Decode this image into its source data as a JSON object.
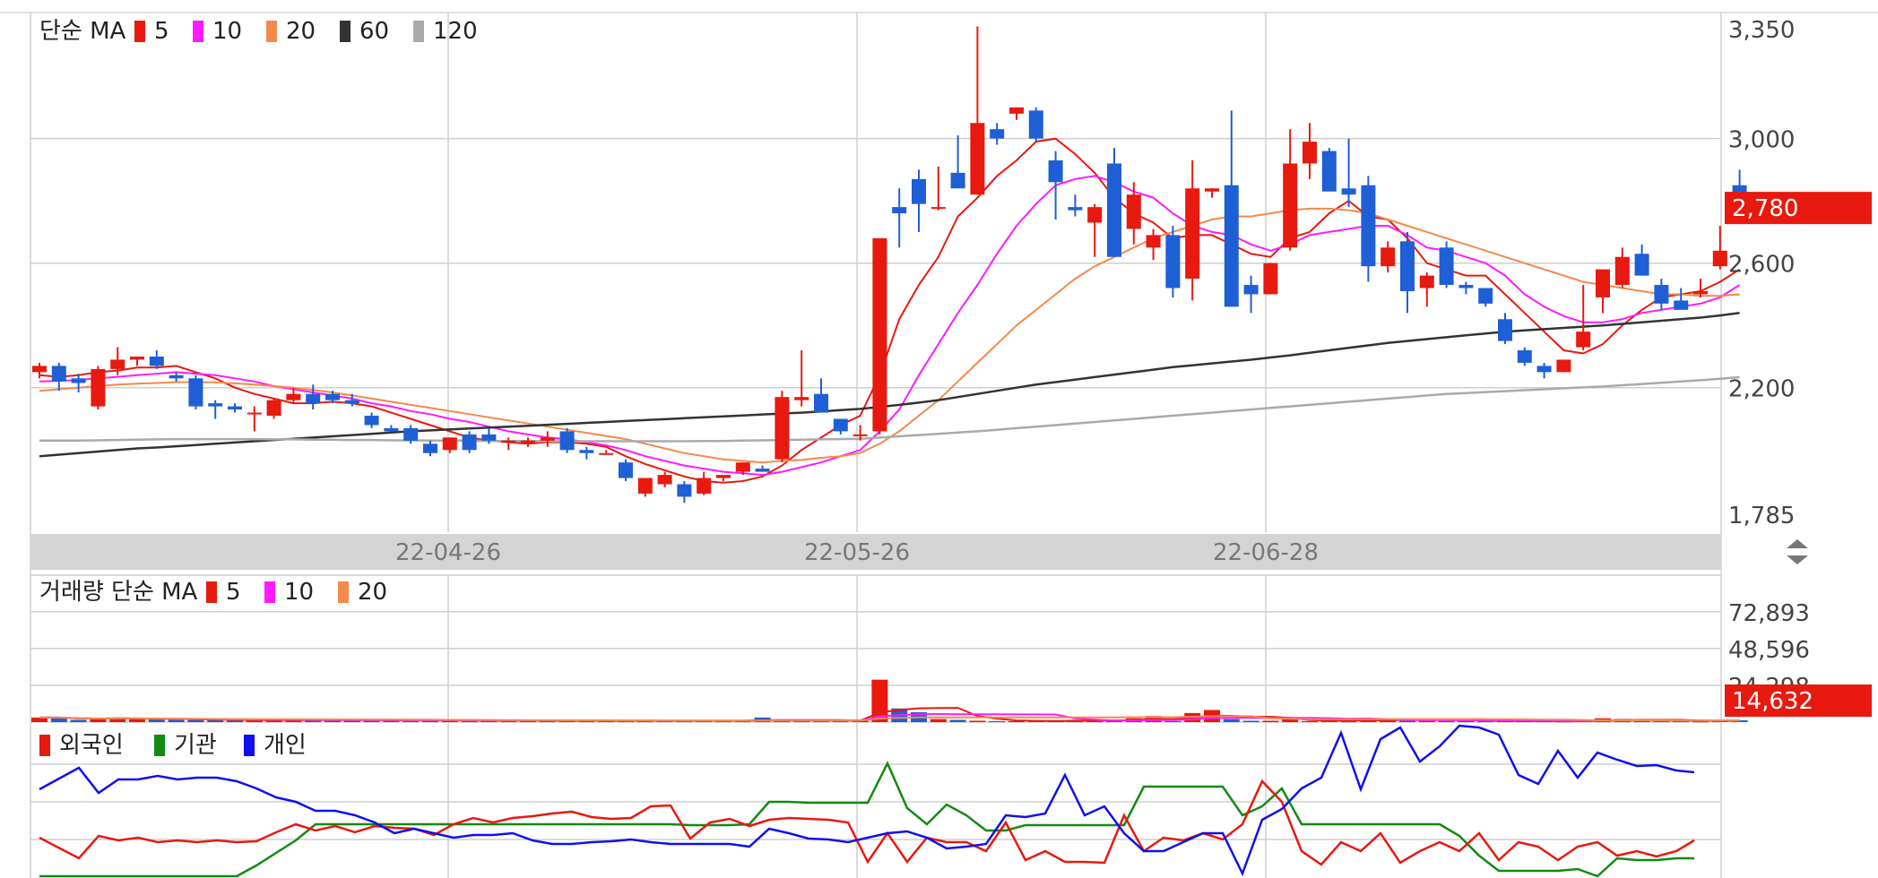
{
  "colors": {
    "up": "#e8190f",
    "down": "#1f5fd6",
    "ma5": "#e8190f",
    "ma10": "#ff1aff",
    "ma20": "#f4894b",
    "ma60": "#333333",
    "ma120": "#aaaaaa",
    "foreign": "#e8190f",
    "institution": "#138a13",
    "individual": "#1010ee",
    "grid": "#cfcfcf",
    "axisband": "#d4d4d4",
    "label_bg": "#e8190f"
  },
  "price_panel": {
    "legend_title": "단순 MA",
    "legend": [
      {
        "label": "5",
        "color": "#e8190f"
      },
      {
        "label": "10",
        "color": "#ff1aff"
      },
      {
        "label": "20",
        "color": "#f4894b"
      },
      {
        "label": "60",
        "color": "#333333"
      },
      {
        "label": "120",
        "color": "#aaaaaa"
      }
    ],
    "y_ticks": [
      "3,350",
      "3,000",
      "2,600",
      "2,200",
      "1,785"
    ],
    "current_label": "2,780"
  },
  "date_axis": {
    "labels": [
      "22-04-26",
      "22-05-26",
      "22-06-28"
    ]
  },
  "volume_panel": {
    "legend_title": "거래량 단순 MA",
    "legend": [
      {
        "label": "5",
        "color": "#e8190f"
      },
      {
        "label": "10",
        "color": "#ff1aff"
      },
      {
        "label": "20",
        "color": "#f4894b"
      }
    ],
    "y_ticks": [
      "72,893",
      "48,596",
      "24,298"
    ],
    "current_label": "14,632"
  },
  "investor_panel": {
    "legend": [
      {
        "label": "외국인",
        "color": "#e8190f"
      },
      {
        "label": "기관",
        "color": "#138a13"
      },
      {
        "label": "개인",
        "color": "#1010ee"
      }
    ]
  },
  "chart_data": {
    "type": "candlestick",
    "x_tick_labels": [
      "22-04-26",
      "22-05-26",
      "22-06-28"
    ],
    "price_ylim": [
      1785,
      3350
    ],
    "candles": [
      [
        2250,
        2280,
        2230,
        2270
      ],
      [
        2270,
        2280,
        2190,
        2220
      ],
      [
        2230,
        2245,
        2185,
        2215
      ],
      [
        2140,
        2270,
        2130,
        2260
      ],
      [
        2260,
        2330,
        2240,
        2290
      ],
      [
        2290,
        2300,
        2270,
        2300
      ],
      [
        2300,
        2320,
        2260,
        2270
      ],
      [
        2240,
        2250,
        2220,
        2230
      ],
      [
        2230,
        2240,
        2130,
        2140
      ],
      [
        2150,
        2160,
        2100,
        2140
      ],
      [
        2140,
        2150,
        2120,
        2130
      ],
      [
        2120,
        2140,
        2060,
        2120
      ],
      [
        2110,
        2165,
        2100,
        2160
      ],
      [
        2160,
        2200,
        2150,
        2180
      ],
      [
        2180,
        2210,
        2130,
        2150
      ],
      [
        2180,
        2190,
        2150,
        2160
      ],
      [
        2160,
        2180,
        2140,
        2150
      ],
      [
        2110,
        2120,
        2070,
        2080
      ],
      [
        2070,
        2080,
        2060,
        2060
      ],
      [
        2070,
        2080,
        2020,
        2030
      ],
      [
        2020,
        2030,
        1980,
        1990
      ],
      [
        2000,
        2040,
        1990,
        2040
      ],
      [
        2050,
        2060,
        1990,
        2000
      ],
      [
        2050,
        2070,
        2020,
        2030
      ],
      [
        2030,
        2040,
        2000,
        2030
      ],
      [
        2020,
        2040,
        2010,
        2030
      ],
      [
        2030,
        2060,
        2010,
        2040
      ],
      [
        2060,
        2070,
        1990,
        2000
      ],
      [
        2000,
        2010,
        1970,
        1990
      ],
      [
        1990,
        2000,
        1990,
        1990
      ],
      [
        1960,
        1970,
        1900,
        1910
      ],
      [
        1860,
        1910,
        1850,
        1910
      ],
      [
        1890,
        1930,
        1880,
        1920
      ],
      [
        1890,
        1900,
        1830,
        1850
      ],
      [
        1860,
        1930,
        1855,
        1910
      ],
      [
        1910,
        1920,
        1900,
        1920
      ],
      [
        1930,
        1960,
        1920,
        1960
      ],
      [
        1940,
        1950,
        1930,
        1930
      ],
      [
        1970,
        2190,
        1960,
        2170
      ],
      [
        2160,
        2320,
        2140,
        2170
      ],
      [
        2180,
        2230,
        2120,
        2120
      ],
      [
        2100,
        2100,
        2050,
        2060
      ],
      [
        2050,
        2080,
        2030,
        2050
      ],
      [
        2060,
        2680,
        2050,
        2680
      ],
      [
        2780,
        2840,
        2650,
        2760
      ],
      [
        2870,
        2900,
        2700,
        2790
      ],
      [
        2780,
        2910,
        2770,
        2780
      ],
      [
        2890,
        3010,
        2880,
        2840
      ],
      [
        2820,
        3360,
        2820,
        3050
      ],
      [
        3030,
        3050,
        2980,
        3000
      ],
      [
        3080,
        3100,
        3060,
        3100
      ],
      [
        3090,
        3100,
        2990,
        3000
      ],
      [
        2930,
        2960,
        2740,
        2860
      ],
      [
        2780,
        2820,
        2750,
        2770
      ],
      [
        2730,
        2790,
        2620,
        2780
      ],
      [
        2920,
        2970,
        2620,
        2620
      ],
      [
        2710,
        2860,
        2660,
        2820
      ],
      [
        2650,
        2710,
        2610,
        2690
      ],
      [
        2690,
        2720,
        2490,
        2520
      ],
      [
        2550,
        2930,
        2480,
        2840
      ],
      [
        2830,
        2840,
        2810,
        2840
      ],
      [
        2850,
        3090,
        2460,
        2460
      ],
      [
        2530,
        2560,
        2440,
        2500
      ],
      [
        2500,
        2600,
        2500,
        2600
      ],
      [
        2650,
        3030,
        2640,
        2920
      ],
      [
        2920,
        3050,
        2870,
        2990
      ],
      [
        2960,
        2970,
        2850,
        2830
      ],
      [
        2840,
        3000,
        2780,
        2820
      ],
      [
        2850,
        2880,
        2540,
        2590
      ],
      [
        2590,
        2670,
        2570,
        2650
      ],
      [
        2670,
        2700,
        2440,
        2510
      ],
      [
        2520,
        2570,
        2460,
        2560
      ],
      [
        2650,
        2670,
        2520,
        2530
      ],
      [
        2530,
        2540,
        2500,
        2520
      ],
      [
        2520,
        2520,
        2460,
        2470
      ],
      [
        2420,
        2440,
        2340,
        2350
      ],
      [
        2320,
        2330,
        2270,
        2280
      ],
      [
        2270,
        2280,
        2230,
        2250
      ],
      [
        2250,
        2290,
        2250,
        2290
      ],
      [
        2330,
        2530,
        2320,
        2380
      ],
      [
        2490,
        2510,
        2440,
        2580
      ],
      [
        2530,
        2650,
        2520,
        2620
      ],
      [
        2630,
        2660,
        2560,
        2560
      ],
      [
        2530,
        2550,
        2450,
        2470
      ],
      [
        2480,
        2520,
        2460,
        2450
      ],
      [
        2500,
        2550,
        2490,
        2510
      ],
      [
        2590,
        2720,
        2580,
        2640
      ],
      [
        2850,
        2900,
        2740,
        2780
      ]
    ],
    "ma_series": [
      {
        "name": "5",
        "values": [
          2240,
          2235,
          2240,
          2250,
          2255,
          2265,
          2265,
          2270,
          2250,
          2230,
          2200,
          2180,
          2165,
          2150,
          2150,
          2155,
          2150,
          2140,
          2120,
          2100,
          2080,
          2060,
          2040,
          2030,
          2025,
          2020,
          2025,
          2025,
          2020,
          2010,
          1980,
          1955,
          1935,
          1915,
          1900,
          1895,
          1900,
          1915,
          1950,
          2000,
          2040,
          2080,
          2110,
          2240,
          2420,
          2530,
          2620,
          2750,
          2810,
          2880,
          2930,
          2990,
          3000,
          2950,
          2890,
          2810,
          2760,
          2730,
          2680,
          2690,
          2690,
          2660,
          2630,
          2620,
          2680,
          2700,
          2760,
          2800,
          2750,
          2740,
          2680,
          2600,
          2580,
          2560,
          2560,
          2500,
          2440,
          2380,
          2320,
          2310,
          2340,
          2400,
          2450,
          2490,
          2500,
          2510,
          2540,
          2580
        ]
      },
      {
        "name": "10",
        "values": [
          2220,
          2222,
          2225,
          2230,
          2235,
          2240,
          2245,
          2250,
          2245,
          2240,
          2230,
          2220,
          2205,
          2195,
          2185,
          2175,
          2165,
          2150,
          2140,
          2125,
          2115,
          2100,
          2090,
          2075,
          2060,
          2050,
          2040,
          2035,
          2025,
          2015,
          2000,
          1980,
          1965,
          1950,
          1940,
          1930,
          1925,
          1920,
          1930,
          1945,
          1960,
          1980,
          2000,
          2060,
          2130,
          2240,
          2340,
          2440,
          2530,
          2630,
          2720,
          2790,
          2850,
          2870,
          2880,
          2860,
          2830,
          2810,
          2760,
          2720,
          2700,
          2690,
          2660,
          2640,
          2660,
          2690,
          2700,
          2710,
          2720,
          2720,
          2690,
          2650,
          2640,
          2620,
          2600,
          2560,
          2500,
          2460,
          2430,
          2410,
          2410,
          2420,
          2440,
          2450,
          2460,
          2470,
          2490,
          2530
        ]
      },
      {
        "name": "20",
        "values": [
          2190,
          2195,
          2200,
          2205,
          2210,
          2213,
          2215,
          2218,
          2218,
          2217,
          2214,
          2210,
          2205,
          2200,
          2193,
          2185,
          2175,
          2165,
          2155,
          2145,
          2135,
          2125,
          2115,
          2105,
          2095,
          2085,
          2075,
          2065,
          2055,
          2045,
          2035,
          2020,
          2005,
          1990,
          1980,
          1970,
          1965,
          1960,
          1965,
          1968,
          1975,
          1980,
          1990,
          2020,
          2060,
          2110,
          2160,
          2220,
          2280,
          2340,
          2400,
          2450,
          2500,
          2550,
          2590,
          2620,
          2650,
          2680,
          2700,
          2720,
          2740,
          2750,
          2750,
          2760,
          2770,
          2775,
          2775,
          2770,
          2760,
          2740,
          2720,
          2700,
          2680,
          2660,
          2640,
          2620,
          2600,
          2580,
          2560,
          2540,
          2530,
          2520,
          2510,
          2500,
          2500,
          2495,
          2495,
          2500
        ]
      },
      {
        "name": "60",
        "values": [
          1980,
          1985,
          1990,
          1995,
          2000,
          2005,
          2008,
          2012,
          2016,
          2020,
          2024,
          2028,
          2032,
          2036,
          2040,
          2044,
          2048,
          2052,
          2056,
          2060,
          2063,
          2066,
          2069,
          2072,
          2075,
          2078,
          2081,
          2084,
          2087,
          2090,
          2093,
          2096,
          2099,
          2102,
          2105,
          2108,
          2111,
          2114,
          2117,
          2120,
          2124,
          2128,
          2132,
          2138,
          2145,
          2152,
          2160,
          2170,
          2180,
          2190,
          2200,
          2210,
          2218,
          2226,
          2234,
          2242,
          2250,
          2258,
          2266,
          2272,
          2278,
          2284,
          2290,
          2297,
          2304,
          2312,
          2320,
          2328,
          2336,
          2344,
          2350,
          2356,
          2362,
          2368,
          2374,
          2380,
          2384,
          2388,
          2392,
          2396,
          2400,
          2405,
          2410,
          2415,
          2420,
          2425,
          2432,
          2440
        ]
      },
      {
        "name": "120",
        "values": [
          2030,
          2030,
          2030,
          2031,
          2032,
          2033,
          2034,
          2035,
          2035,
          2035,
          2035,
          2035,
          2034,
          2034,
          2033,
          2033,
          2032,
          2032,
          2031,
          2031,
          2030,
          2030,
          2030,
          2029,
          2029,
          2029,
          2028,
          2028,
          2028,
          2028,
          2028,
          2028,
          2028,
          2028,
          2029,
          2029,
          2030,
          2031,
          2032,
          2033,
          2034,
          2035,
          2036,
          2040,
          2044,
          2048,
          2052,
          2056,
          2060,
          2065,
          2070,
          2075,
          2080,
          2085,
          2090,
          2095,
          2100,
          2105,
          2110,
          2115,
          2120,
          2125,
          2130,
          2135,
          2140,
          2145,
          2150,
          2155,
          2160,
          2165,
          2170,
          2175,
          2180,
          2183,
          2186,
          2189,
          2192,
          2195,
          2198,
          2201,
          2204,
          2208,
          2212,
          2216,
          2220,
          2224,
          2229,
          2234
        ]
      }
    ],
    "volume_ylim": [
      0,
      97000
    ],
    "volume": [
      3000,
      3000,
      1500,
      2000,
      3000,
      2000,
      1800,
      1500,
      1500,
      1500,
      1200,
      1200,
      1500,
      1500,
      1200,
      1200,
      1200,
      1500,
      1200,
      1000,
      1200,
      1000,
      1000,
      1000,
      1000,
      1000,
      900,
      900,
      900,
      900,
      900,
      900,
      900,
      900,
      900,
      900,
      900,
      3000,
      900,
      900,
      1000,
      1000,
      1000,
      28000,
      9000,
      6500,
      2000,
      1500,
      900,
      600,
      600,
      600,
      800,
      1500,
      1500,
      800,
      2500,
      4000,
      700,
      6000,
      8000,
      2000,
      900,
      900,
      2000,
      600,
      800,
      500,
      2000,
      2000,
      2000,
      900,
      800,
      900,
      800,
      600,
      600,
      600,
      500,
      800,
      2500,
      2000,
      1500,
      700,
      600,
      500,
      800,
      1200
    ],
    "volume_series": [
      {
        "name": "5",
        "values": []
      },
      {
        "name": "10",
        "values": []
      },
      {
        "name": "20",
        "values": []
      }
    ],
    "investor_series": [
      {
        "name": "외국인",
        "values": []
      },
      {
        "name": "기관",
        "values": []
      },
      {
        "name": "개인",
        "values": []
      }
    ]
  }
}
